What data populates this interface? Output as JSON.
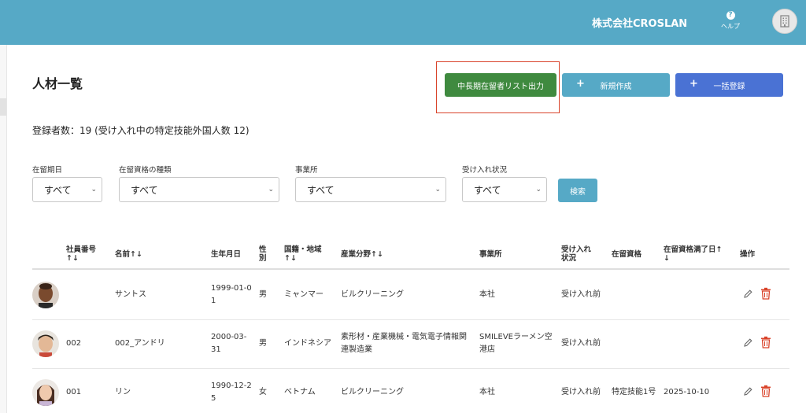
{
  "header": {
    "company_name": "株式会社CROSLAN",
    "help_label": "ヘルプ",
    "help_icon_glyph": "?",
    "accent_color": "#56a9c6"
  },
  "page": {
    "title": "人材一覧",
    "count_text": "登録者数：19 (受け入れ中の特定技能外国人数 12)"
  },
  "actions": {
    "export_label": "中長期在留者リスト出力",
    "new_label": "新規作成",
    "bulk_label": "一括登録",
    "plus_glyph": "+"
  },
  "filters": {
    "stay_period": {
      "label": "在留期日",
      "value": "すべて"
    },
    "visa_type": {
      "label": "在留資格の種類",
      "value": "すべて"
    },
    "office": {
      "label": "事業所",
      "value": "すべて"
    },
    "status": {
      "label": "受け入れ状況",
      "value": "すべて"
    },
    "search_label": "検索"
  },
  "table": {
    "headers": {
      "emp_no": [
        "社員番号",
        "↑↓"
      ],
      "name": "名前↑↓",
      "birth": "生年月日",
      "gender": [
        "性",
        "別"
      ],
      "country": [
        "国籍・地域",
        "↑↓"
      ],
      "industry": "産業分野↑↓",
      "office": "事業所",
      "status": [
        "受け入れ",
        "状況"
      ],
      "visa": "在留資格",
      "expiry": [
        "在留資格満了日↑",
        "↓"
      ],
      "ops": "操作"
    },
    "rows": [
      {
        "emp_no": "",
        "name": "サントス",
        "birth": [
          "1999-01-0",
          "1"
        ],
        "gender": "男",
        "country": "ミャンマー",
        "industry": [
          "ビルクリーニング",
          ""
        ],
        "office": [
          "本社",
          ""
        ],
        "status": "受け入れ前",
        "visa": "",
        "expiry": ""
      },
      {
        "emp_no": "002",
        "name": "002_アンドリ",
        "birth": [
          "2000-03-",
          "31"
        ],
        "gender": "男",
        "country": "インドネシア",
        "industry": [
          "素形材・産業機械・電気電子情報関",
          "連製造業"
        ],
        "office": [
          "SMILEVEラーメン空",
          "港店"
        ],
        "status": "受け入れ前",
        "visa": "",
        "expiry": ""
      },
      {
        "emp_no": "001",
        "name": "リン",
        "birth": [
          "1990-12-2",
          "5"
        ],
        "gender": "女",
        "country": "ベトナム",
        "industry": [
          "ビルクリーニング",
          ""
        ],
        "office": [
          "本社",
          ""
        ],
        "status": "受け入れ前",
        "visa": "特定技能1号",
        "expiry": "2025-10-10"
      }
    ]
  },
  "colors": {
    "export_button": "#3f8a3f",
    "new_button": "#56a9c6",
    "bulk_button": "#4a72d4",
    "highlight_border": "#d9432a",
    "delete_icon": "#d9432a"
  }
}
